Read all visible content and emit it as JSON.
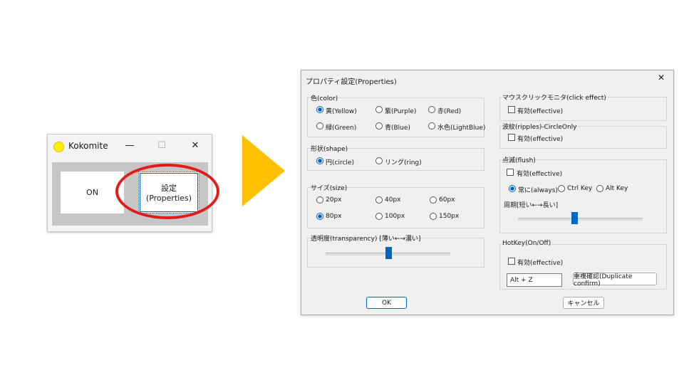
{
  "small_window": {
    "title": "Kokomite",
    "minimize": "—",
    "maximize": "☐",
    "close": "✕",
    "on_button": "ON",
    "settings_button_line1": "設定",
    "settings_button_line2": "(Properties)"
  },
  "dialog": {
    "title": "プロパティ設定(Properties)",
    "close": "✕",
    "color_group": {
      "label": "色(color)",
      "options": [
        "黄(Yellow)",
        "紫(Purple)",
        "赤(Red)",
        "緑(Green)",
        "青(Blue)",
        "水色(LightBlue)"
      ],
      "selected": "黄(Yellow)"
    },
    "shape_group": {
      "label": "形状(shape)",
      "options": [
        "円(circle)",
        "リング(ring)"
      ],
      "selected": "円(circle)"
    },
    "size_group": {
      "label": "サイズ(size)",
      "options": [
        "20px",
        "40px",
        "60px",
        "80px",
        "100px",
        "150px"
      ],
      "selected": "80px"
    },
    "transparency_group": {
      "label": "透明度(transparency) [薄い←→濃い]",
      "level": 0.5
    },
    "mouse_click_group": {
      "label": "マウスクリックモニタ(click effect)",
      "checkbox": "有効(effective)",
      "checked": false
    },
    "ripples_group": {
      "label": "波紋(ripples)-CircleOnly",
      "checkbox": "有効(effective)",
      "checked": false
    },
    "flush_group": {
      "label": "点滅(flush)",
      "checkbox": "有効(effective)",
      "checked": false,
      "options": [
        "常に(always)",
        "Ctrl Key",
        "Alt Key"
      ],
      "selected": "常に(always)",
      "period_label": "周期[短い←→長い]",
      "period_level": 0.45
    },
    "hotkey_group": {
      "label": "HotKey(On/Off)",
      "checkbox": "有効(effective)",
      "checked": false,
      "value": "Alt + Z",
      "confirm_button": "重複確認(Duplicate confirm)"
    },
    "ok_button": "OK",
    "cancel_button": "キャンセル"
  },
  "colors": {
    "arrow": "#ffc000",
    "highlight_ellipse": "#e21a1a",
    "accent": "#0067c0",
    "indicator": "#ffef00"
  }
}
